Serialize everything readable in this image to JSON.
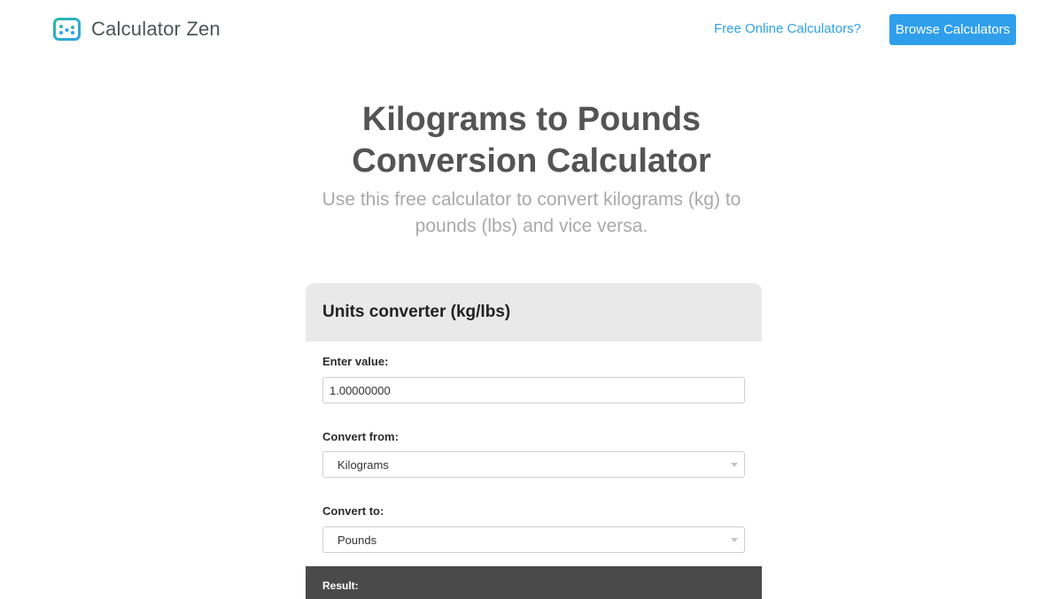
{
  "header": {
    "brand_name": "Calculator Zen",
    "nav_link": "Free Online Calculators?",
    "browse_button": "Browse Calculators"
  },
  "hero": {
    "title_line1": "Kilograms to Pounds",
    "title_line2": "Conversion Calculator",
    "subtitle_line1": "Use this free calculator to convert kilograms (kg) to",
    "subtitle_line2": "pounds (lbs) and vice versa."
  },
  "converter": {
    "title": "Units converter (kg/lbs)",
    "value_label": "Enter value:",
    "value": "1.00000000",
    "from_label": "Convert from:",
    "from_value": "Kilograms",
    "to_label": "Convert to:",
    "to_value": "Pounds",
    "result_label": "Result:"
  },
  "colors": {
    "accent": "#2f9fec",
    "link": "#2ea3e6",
    "logo_green": "#2bb7a3",
    "logo_blue": "#2ea3e6",
    "result_bar": "#4a4a4a"
  },
  "icons": [
    "calculator-logo-icon",
    "chevron-down-icon"
  ]
}
